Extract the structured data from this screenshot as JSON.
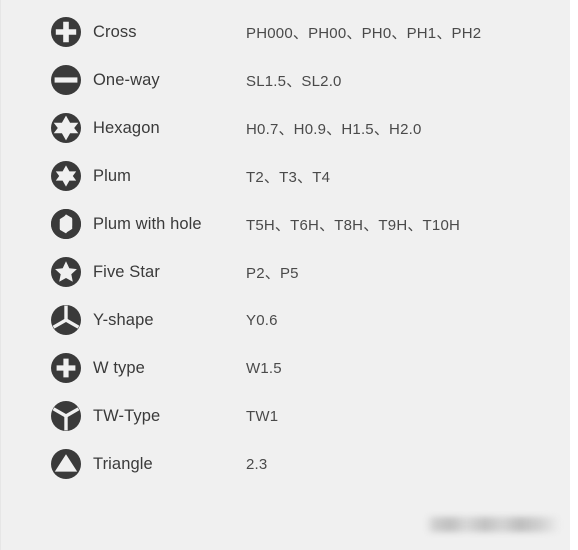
{
  "sheet": {
    "background_color": "#f0f0f0",
    "text_color": "#3a3a3a",
    "icon_color": "#3a3a3a",
    "watermark_text": ""
  },
  "rows": [
    {
      "icon": "cross-bit-icon",
      "name": "Cross",
      "sizes": "PH000、PH00、PH0、PH1、PH2"
    },
    {
      "icon": "one-way-bit-icon",
      "name": "One-way",
      "sizes": "SL1.5、SL2.0"
    },
    {
      "icon": "hexagon-bit-icon",
      "name": "Hexagon",
      "sizes": "H0.7、H0.9、H1.5、H2.0"
    },
    {
      "icon": "plum-bit-icon",
      "name": "Plum",
      "sizes": "T2、T3、T4"
    },
    {
      "icon": "plum-with-hole-bit-icon",
      "name": "Plum with hole",
      "sizes": "T5H、T6H、T8H、T9H、T10H"
    },
    {
      "icon": "five-star-bit-icon",
      "name": "Five Star",
      "sizes": "P2、P5"
    },
    {
      "icon": "y-shape-bit-icon",
      "name": "Y-shape",
      "sizes": "Y0.6"
    },
    {
      "icon": "w-type-bit-icon",
      "name": "W type",
      "sizes": "W1.5"
    },
    {
      "icon": "tw-type-bit-icon",
      "name": "TW-Type",
      "sizes": "TW1"
    },
    {
      "icon": "triangle-bit-icon",
      "name": "Triangle",
      "sizes": "2.3"
    }
  ]
}
